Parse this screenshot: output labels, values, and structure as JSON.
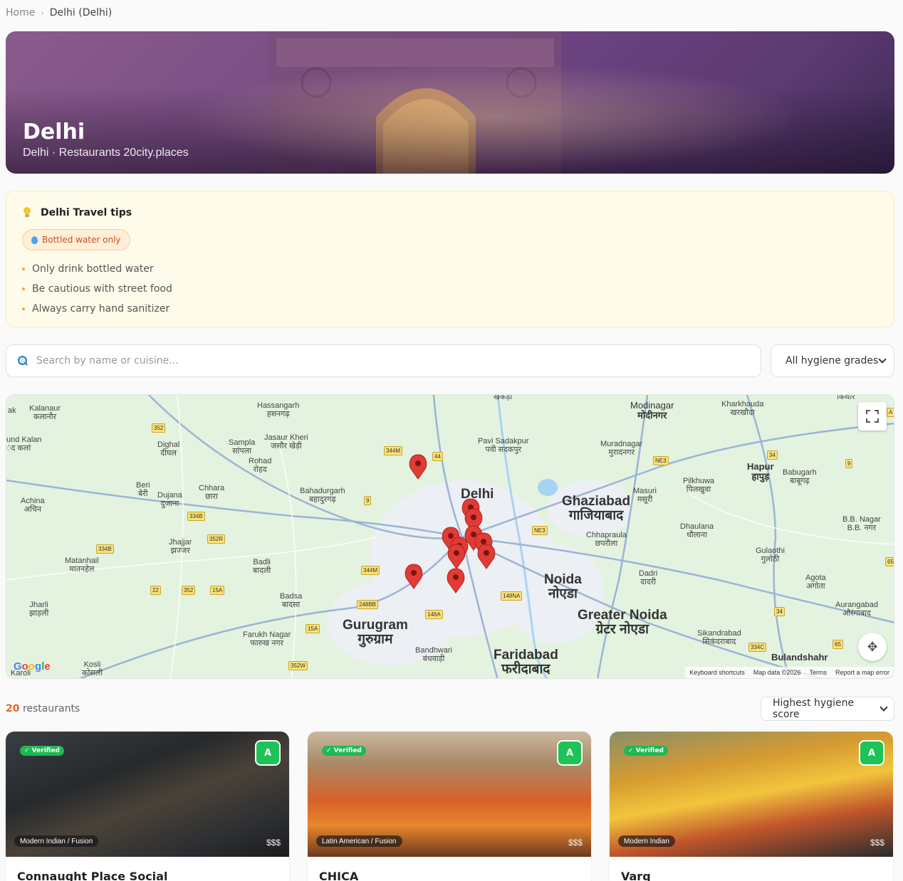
{
  "breadcrumb": {
    "home": "Home",
    "separator": "›",
    "current": "Delhi (Delhi)"
  },
  "hero": {
    "title": "Delhi",
    "subtitle": "Delhi · Restaurants 20city.places"
  },
  "tips": {
    "title": "Delhi Travel tips",
    "badge": "Bottled water only",
    "items": [
      "Only drink bottled water",
      "Be cautious with street food",
      "Always carry hand sanitizer"
    ]
  },
  "search": {
    "placeholder": "Search by name or cuisine...",
    "value": ""
  },
  "filter": {
    "hygiene_select": "All hygiene grades"
  },
  "map": {
    "labels": {
      "modinagar": "Modinagar",
      "modinagar_hi": "मोदीनगर",
      "ghaziabad": "Ghaziabad",
      "ghaziabad_hi": "गाजियाबाद",
      "noida": "Noida",
      "noida_hi": "नोएडा",
      "greater_noida": "Greater Noida",
      "greater_noida_hi": "ग्रेटर नोएडा",
      "gurugram": "Gurugram",
      "gurugram_hi": "गुरुग्राम",
      "faridabad": "Faridabad",
      "faridabad_hi": "फरीदाबाद",
      "delhi": "Delhi",
      "hapur": "Hapur",
      "hapur_hi": "हापुड़",
      "bulandshahr": "Bulandshahr",
      "hassangarh": "Hassangarh",
      "hassangarh_hi": "हसनगढ़",
      "kalanaur": "Kalanaur",
      "kalanaur_hi": "कलानौर",
      "sampla": "Sampla",
      "sampla_hi": "सांपला",
      "jasaur_kheri": "Jasaur Kheri",
      "jasaur_kheri_hi": "जसौर खेड़ी",
      "rohad": "Rohad",
      "rohad_hi": "रोहद",
      "dighal": "Dighal",
      "dighal_hi": "दीघल",
      "bahadurgarh": "Bahadurgarh",
      "bahadurgarh_hi": "बहादुरगढ़",
      "chhara": "Chhara",
      "chhara_hi": "छारा",
      "beri": "Beri",
      "beri_hi": "बेरी",
      "dujana": "Dujana",
      "dujana_hi": "दुजाना",
      "achina": "Achina",
      "achina_hi": "अचिन",
      "jhajjar": "Jhajjar",
      "jhajjar_hi": "झज्जर",
      "matanhail": "Matanhail",
      "matanhail_hi": "मातनहेल",
      "badli": "Badli",
      "badli_hi": "बादली",
      "badsa": "Badsa",
      "badsa_hi": "बादसा",
      "jharli": "Jharli",
      "jharli_hi": "झाड़ली",
      "farukh_nagar": "Farukh Nagar",
      "farukh_nagar_hi": "फारुख नगर",
      "bandhwari": "Bandhwari",
      "bandhwari_hi": "बंधवाड़ी",
      "kosli": "Kosli",
      "kosli_hi": "कोसली",
      "pavi_sadakpur": "Pavi Sadakpur",
      "pavi_sadakpur_hi": "पवी सदकपुर",
      "muradnagar": "Muradnagar",
      "muradnagar_hi": "मुरादनगर",
      "masuri": "Masuri",
      "masuri_hi": "मसूरी",
      "pilkhuwa": "Pilkhuwa",
      "pilkhuwa_hi": "पिलखुवा",
      "babugarh": "Babugarh",
      "babugarh_hi": "बाबूगढ़",
      "kharkhauda": "Kharkhauda",
      "kharkhauda_hi": "खरखौदा",
      "chhapraula": "Chhapraula",
      "chhapraula_hi": "छपरौला",
      "dhaulana": "Dhaulana",
      "dhaulana_hi": "धौलाना",
      "dadri": "Dadri",
      "dadri_hi": "दादरी",
      "gulaothi": "Gulaothi",
      "gulaothi_hi": "गुलोठी",
      "agota": "Agota",
      "agota_hi": "अगोता",
      "aurangabad": "Aurangabad",
      "aurangabad_hi": "औरंगाबाद",
      "sikandrabad": "Sikandrabad",
      "sikandrabad_hi": "सिकंदराबाद",
      "bb_nagar": "B.B. Nagar",
      "bb_nagar_hi": "B.B. नगर",
      "und_kalan": "und Kalan",
      "und_kalan_hi": "ंद कलां",
      "ak": "ak",
      "karoli": "Karoli",
      "kithor": "किथौर",
      "khekra": "खेकड़ा"
    },
    "shields": [
      "352",
      "344M",
      "44",
      "NE3",
      "34",
      "9",
      "9",
      "334B",
      "352R",
      "334B",
      "344M",
      "NE3",
      "248BB",
      "148NA",
      "148A",
      "22",
      "352",
      "15A",
      "15A",
      "352W",
      "34",
      "334C",
      "65",
      "65",
      "A"
    ],
    "footer": {
      "shortcuts": "Keyboard shortcuts",
      "data": "Map data ©2026",
      "terms": "Terms",
      "report": "Report a map error"
    },
    "google": "Google",
    "colors": {
      "marker": "#e23b36",
      "land": "#e3f3e0",
      "water": "#a9d3f3",
      "road": "#ffffff"
    }
  },
  "results": {
    "count": "20",
    "label": "restaurants",
    "sort": "Highest hygiene score"
  },
  "cards": [
    {
      "name": "Connaught Place Social",
      "cuisine": "Modern Indian / Fusion",
      "price": "$$$",
      "grade": "A",
      "verified": "✓ Verified"
    },
    {
      "name": "CHICA",
      "cuisine": "Latin American / Fusion",
      "price": "$$$",
      "grade": "A",
      "verified": "✓ Verified"
    },
    {
      "name": "Varq",
      "cuisine": "Modern Indian",
      "price": "$$$",
      "grade": "A",
      "verified": "✓ Verified"
    }
  ]
}
